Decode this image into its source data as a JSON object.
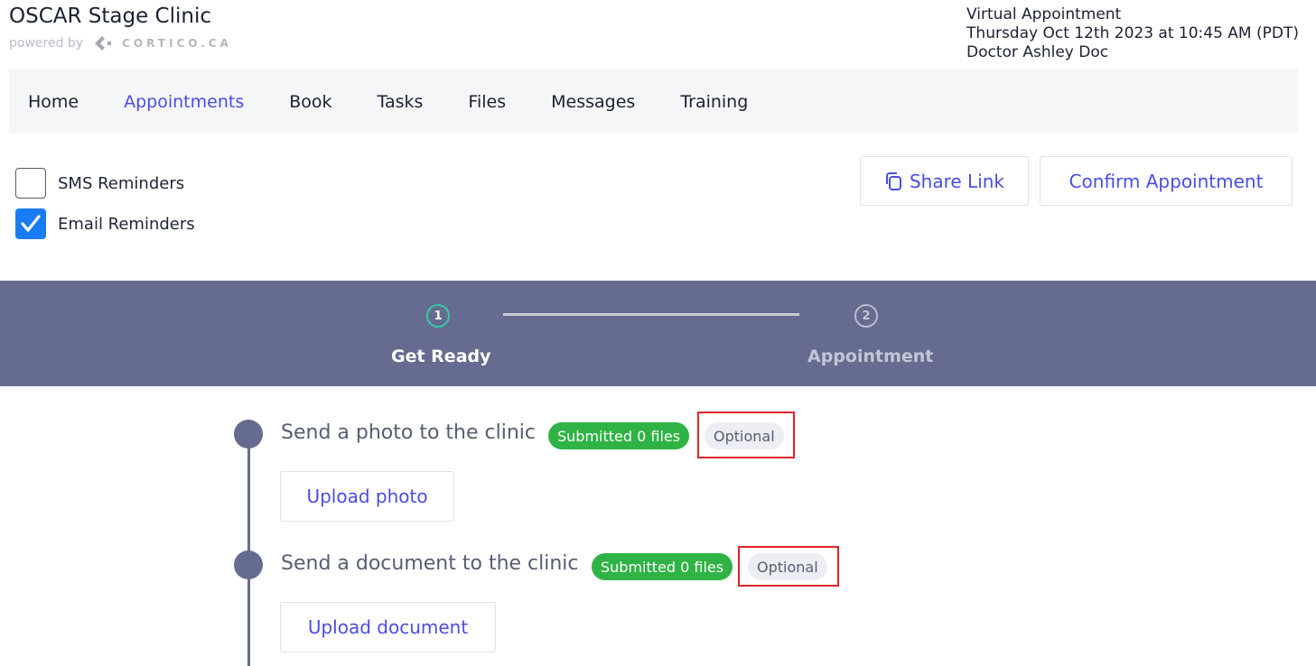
{
  "header": {
    "clinic_name": "OSCAR Stage Clinic",
    "powered_by": "powered by",
    "brand": "CORTICO.CA",
    "appointment": {
      "type": "Virtual Appointment",
      "datetime": "Thursday Oct 12th 2023 at 10:45 AM (PDT)",
      "doctor": "Doctor Ashley Doc"
    }
  },
  "nav": {
    "items": [
      {
        "label": "Home",
        "active": false
      },
      {
        "label": "Appointments",
        "active": true
      },
      {
        "label": "Book",
        "active": false
      },
      {
        "label": "Tasks",
        "active": false
      },
      {
        "label": "Files",
        "active": false
      },
      {
        "label": "Messages",
        "active": false
      },
      {
        "label": "Training",
        "active": false
      }
    ]
  },
  "reminders": {
    "sms": {
      "label": "SMS Reminders",
      "checked": false
    },
    "email": {
      "label": "Email Reminders",
      "checked": true
    }
  },
  "actions": {
    "share_link": "Share Link",
    "confirm_appointment": "Confirm Appointment"
  },
  "stepper": {
    "steps": [
      {
        "number": "1",
        "label": "Get Ready",
        "active": true
      },
      {
        "number": "2",
        "label": "Appointment",
        "active": false
      }
    ]
  },
  "tasks": [
    {
      "title": "Send a photo to the clinic",
      "status": "Submitted 0 files",
      "tag": "Optional",
      "button": "Upload photo"
    },
    {
      "title": "Send a document to the clinic",
      "status": "Submitted 0 files",
      "tag": "Optional",
      "button": "Upload document"
    }
  ],
  "colors": {
    "accent": "#4a4ce6",
    "stepper_bg": "#656c8f",
    "success": "#2fb344",
    "checkbox": "#1a7cf5",
    "highlight": "#e0242a"
  }
}
